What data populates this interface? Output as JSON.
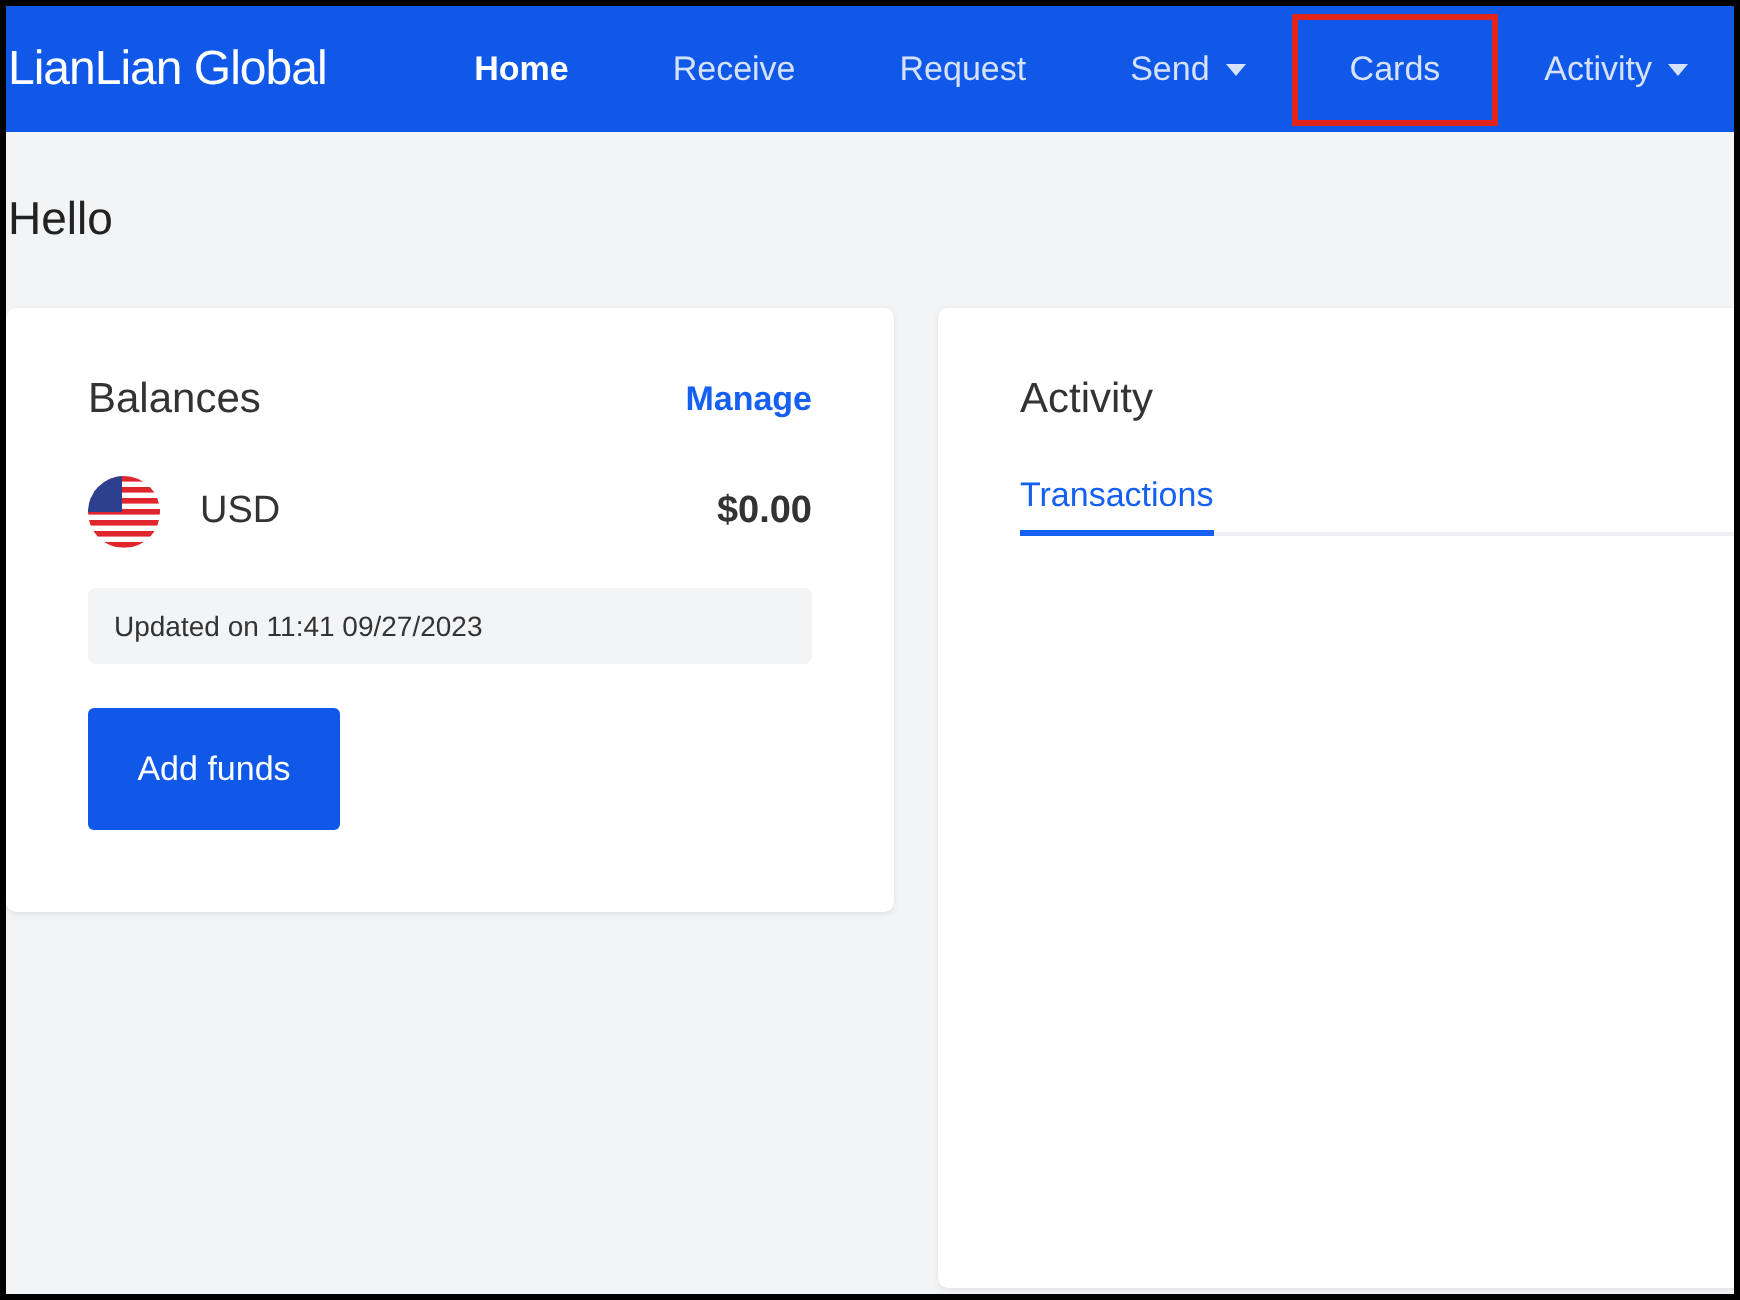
{
  "brand": "LianLian Global",
  "nav": [
    {
      "label": "Home",
      "selected": true,
      "dropdown": false,
      "highlighted": false
    },
    {
      "label": "Receive",
      "selected": false,
      "dropdown": false,
      "highlighted": false
    },
    {
      "label": "Request",
      "selected": false,
      "dropdown": false,
      "highlighted": false
    },
    {
      "label": "Send",
      "selected": false,
      "dropdown": true,
      "highlighted": false
    },
    {
      "label": "Cards",
      "selected": false,
      "dropdown": false,
      "highlighted": true
    },
    {
      "label": "Activity",
      "selected": false,
      "dropdown": true,
      "highlighted": false
    }
  ],
  "greeting": "Hello",
  "balances": {
    "title": "Balances",
    "manage": "Manage",
    "currency": "USD",
    "amount": "$0.00",
    "updated": "Updated on 11:41 09/27/2023",
    "button": "Add funds"
  },
  "activity": {
    "title": "Activity",
    "tabs": [
      {
        "label": "Transactions",
        "selected": true
      }
    ]
  }
}
